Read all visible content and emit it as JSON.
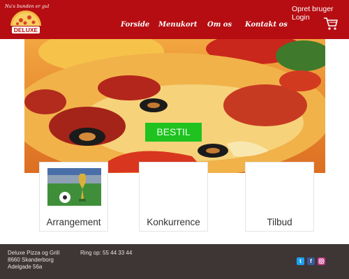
{
  "brand": {
    "tagline": "Nu's bunden er gul",
    "name": "DELUXE",
    "color": "#b50d12"
  },
  "nav": [
    {
      "label": "Forside"
    },
    {
      "label": "Menukort"
    },
    {
      "label": "Om os"
    },
    {
      "label": "Kontakt os"
    }
  ],
  "account": {
    "register": "Opret bruger",
    "login": "Login",
    "cart_icon": "shopping-cart-icon"
  },
  "hero": {
    "cta": "BESTIL",
    "cta_color": "#1fc21f"
  },
  "cards": [
    {
      "label": "Arrangement",
      "icon": "world-cup-trophy-image"
    },
    {
      "label": "Konkurrence"
    },
    {
      "label": "Tilbud"
    }
  ],
  "footer": {
    "address": [
      "Deluxe Pizza og Grill",
      "8660 Skanderborg",
      "Adelgade 56a"
    ],
    "phone": "Ring op: 55 44 33 44",
    "social": [
      {
        "icon": "twitter-icon",
        "color": "#1da1f2"
      },
      {
        "icon": "facebook-icon",
        "color": "#3b5998"
      },
      {
        "icon": "instagram-icon",
        "color": "#c13584"
      }
    ]
  }
}
